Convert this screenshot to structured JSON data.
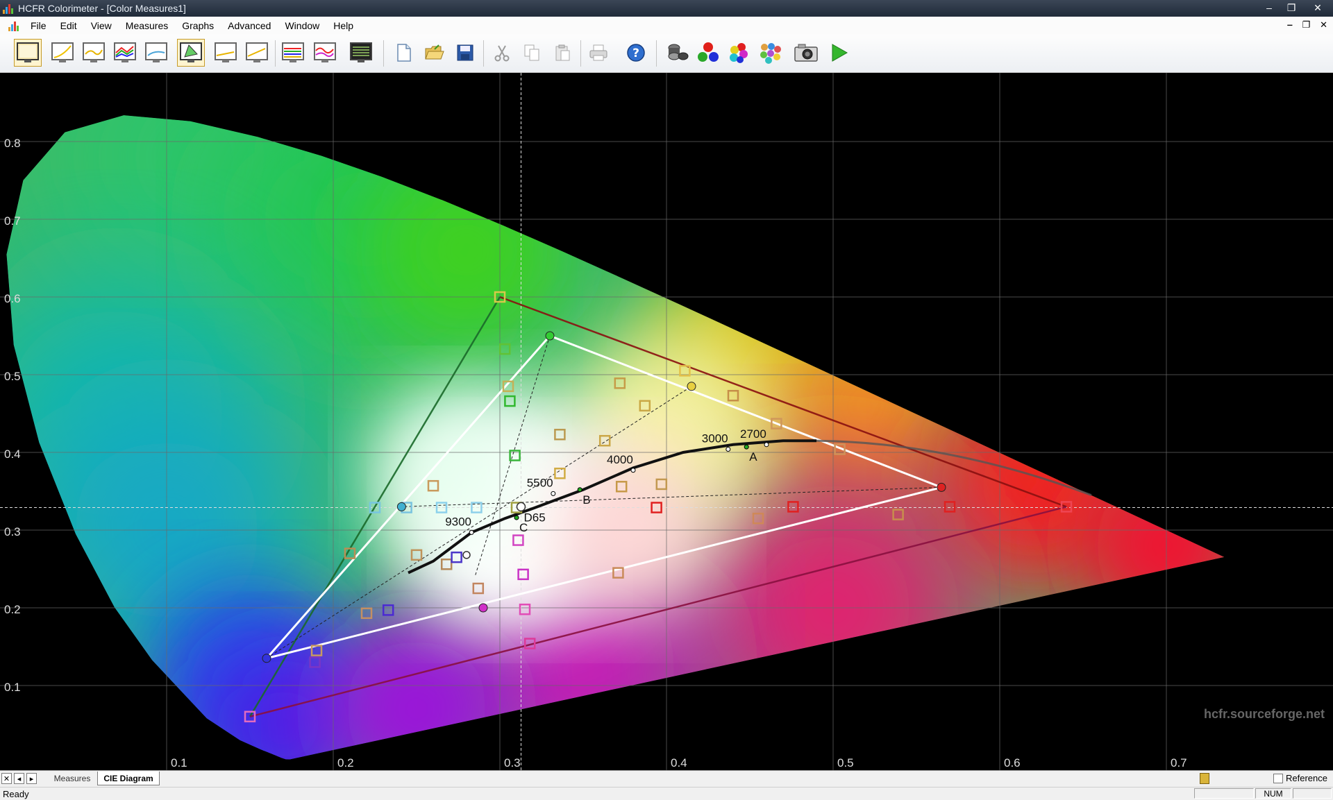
{
  "window": {
    "title": "HCFR Colorimeter - [Color Measures1]",
    "minimize_glyph": "‒",
    "restore_glyph": "❐",
    "close_glyph": "✕"
  },
  "menu": {
    "items": [
      "File",
      "Edit",
      "View",
      "Measures",
      "Graphs",
      "Advanced",
      "Window",
      "Help"
    ],
    "mdi_minimize_glyph": "‒",
    "mdi_restore_glyph": "❐",
    "mdi_close_glyph": "✕"
  },
  "toolbar": {
    "icons": [
      "summary-view-icon",
      "luminance-graph-icon",
      "gamma-graph-icon",
      "rgb-levels-graph-icon",
      "color-temperature-graph-icon",
      "cie-diagram-icon",
      "delta-e-graph-icon",
      "saturation-luminance-graph-icon",
      "saturation-shift-graph-icon",
      "near-black-graph-icon",
      "measures-grid-icon",
      "new-document-icon",
      "open-folder-icon",
      "save-icon",
      "cut-icon",
      "copy-icon",
      "paste-icon",
      "print-icon",
      "help-icon",
      "sensor-icon",
      "primary-colors-icon",
      "secondary-colors-icon",
      "color-checker-icon",
      "camera-icon",
      "play-icon"
    ],
    "pressed": [
      "summary-view-icon",
      "cie-diagram-icon"
    ]
  },
  "chart": {
    "watermark": "hcfr.sourceforge.net",
    "x_ticks": [
      "0.1",
      "0.2",
      "0.3",
      "0.4",
      "0.5",
      "0.6",
      "0.7"
    ],
    "y_ticks": [
      "0.1",
      "0.2",
      "0.3",
      "0.4",
      "0.5",
      "0.6",
      "0.7",
      "0.8"
    ],
    "temp_labels": [
      "9300",
      "5500",
      "4000",
      "3000",
      "2700"
    ],
    "illuminants": [
      "D65",
      "C",
      "B",
      "A"
    ],
    "reference_gamut": {
      "red": [
        0.64,
        0.33
      ],
      "green": [
        0.3,
        0.6
      ],
      "blue": [
        0.15,
        0.06
      ]
    },
    "measured_gamut": {
      "red": [
        0.565,
        0.355
      ],
      "green": [
        0.33,
        0.55
      ],
      "blue": [
        0.16,
        0.135
      ]
    },
    "white_point": [
      0.3127,
      0.329
    ],
    "blackbody_curve": [
      [
        0.245,
        0.245
      ],
      [
        0.26,
        0.26
      ],
      [
        0.283,
        0.297
      ],
      [
        0.303,
        0.315
      ],
      [
        0.32,
        0.328
      ],
      [
        0.35,
        0.352
      ],
      [
        0.38,
        0.38
      ],
      [
        0.41,
        0.4
      ],
      [
        0.44,
        0.41
      ],
      [
        0.47,
        0.415
      ],
      [
        0.49,
        0.415
      ]
    ],
    "temp_points": [
      {
        "label": "9300",
        "x": 0.283,
        "y": 0.297
      },
      {
        "label": "5500",
        "x": 0.332,
        "y": 0.347
      },
      {
        "label": "4000",
        "x": 0.38,
        "y": 0.377
      },
      {
        "label": "3000",
        "x": 0.437,
        "y": 0.404
      },
      {
        "label": "2700",
        "x": 0.46,
        "y": 0.41
      }
    ],
    "illuminant_points": [
      {
        "label": "D65",
        "x": 0.3127,
        "y": 0.329
      },
      {
        "label": "C",
        "x": 0.31,
        "y": 0.316
      },
      {
        "label": "B",
        "x": 0.348,
        "y": 0.352
      },
      {
        "label": "A",
        "x": 0.448,
        "y": 0.407
      }
    ],
    "sample_squares": [
      {
        "x": 0.3,
        "y": 0.6,
        "c": "#d7c84a"
      },
      {
        "x": 0.303,
        "y": 0.533,
        "c": "#61c235"
      },
      {
        "x": 0.305,
        "y": 0.485,
        "c": "#c5b156"
      },
      {
        "x": 0.306,
        "y": 0.466,
        "c": "#2fb82d"
      },
      {
        "x": 0.309,
        "y": 0.396,
        "c": "#38b53a"
      },
      {
        "x": 0.31,
        "y": 0.329,
        "c": "#a0a040"
      },
      {
        "x": 0.411,
        "y": 0.505,
        "c": "#e3c04a"
      },
      {
        "x": 0.372,
        "y": 0.489,
        "c": "#c69c48"
      },
      {
        "x": 0.387,
        "y": 0.46,
        "c": "#caa845"
      },
      {
        "x": 0.336,
        "y": 0.423,
        "c": "#bb9a50"
      },
      {
        "x": 0.363,
        "y": 0.415,
        "c": "#cba747"
      },
      {
        "x": 0.336,
        "y": 0.373,
        "c": "#d1ac44"
      },
      {
        "x": 0.373,
        "y": 0.356,
        "c": "#c79949"
      },
      {
        "x": 0.397,
        "y": 0.359,
        "c": "#c39951"
      },
      {
        "x": 0.44,
        "y": 0.473,
        "c": "#c68f49"
      },
      {
        "x": 0.466,
        "y": 0.437,
        "c": "#d0975a"
      },
      {
        "x": 0.504,
        "y": 0.404,
        "c": "#cf925a"
      },
      {
        "x": 0.394,
        "y": 0.329,
        "c": "#e02020"
      },
      {
        "x": 0.476,
        "y": 0.33,
        "c": "#e02020"
      },
      {
        "x": 0.455,
        "y": 0.315,
        "c": "#cf8858"
      },
      {
        "x": 0.539,
        "y": 0.32,
        "c": "#c88d4d"
      },
      {
        "x": 0.57,
        "y": 0.33,
        "c": "#e02020"
      },
      {
        "x": 0.225,
        "y": 0.329,
        "c": "#77c5e0"
      },
      {
        "x": 0.244,
        "y": 0.329,
        "c": "#79c3df"
      },
      {
        "x": 0.265,
        "y": 0.329,
        "c": "#8cd1eb"
      },
      {
        "x": 0.286,
        "y": 0.329,
        "c": "#8ed0ea"
      },
      {
        "x": 0.26,
        "y": 0.357,
        "c": "#c99a5c"
      },
      {
        "x": 0.21,
        "y": 0.27,
        "c": "#b98f55"
      },
      {
        "x": 0.25,
        "y": 0.268,
        "c": "#bf935a"
      },
      {
        "x": 0.268,
        "y": 0.256,
        "c": "#b58a58"
      },
      {
        "x": 0.274,
        "y": 0.265,
        "c": "#4b36c9"
      },
      {
        "x": 0.22,
        "y": 0.193,
        "c": "#c38f63"
      },
      {
        "x": 0.233,
        "y": 0.197,
        "c": "#4b2ad2"
      },
      {
        "x": 0.19,
        "y": 0.145,
        "c": "#c79961"
      },
      {
        "x": 0.189,
        "y": 0.13,
        "c": "#7b35c5"
      },
      {
        "x": 0.287,
        "y": 0.225,
        "c": "#c2855f"
      },
      {
        "x": 0.311,
        "y": 0.287,
        "c": "#d245c2"
      },
      {
        "x": 0.314,
        "y": 0.243,
        "c": "#c932c5"
      },
      {
        "x": 0.315,
        "y": 0.198,
        "c": "#e24cb6"
      },
      {
        "x": 0.318,
        "y": 0.154,
        "c": "#dd3b99"
      },
      {
        "x": 0.371,
        "y": 0.245,
        "c": "#c98a59"
      },
      {
        "x": 0.15,
        "y": 0.06,
        "c": "#e16bc0"
      },
      {
        "x": 0.64,
        "y": 0.33,
        "c": "#ef4553"
      }
    ]
  },
  "tabs": {
    "items": [
      "Measures",
      "CIE Diagram"
    ],
    "first_glyph": "✕",
    "prev_glyph": "◂",
    "next_glyph": "▸"
  },
  "reference_checkbox": {
    "label": "Reference"
  },
  "status": {
    "ready": "Ready",
    "num": "NUM"
  }
}
